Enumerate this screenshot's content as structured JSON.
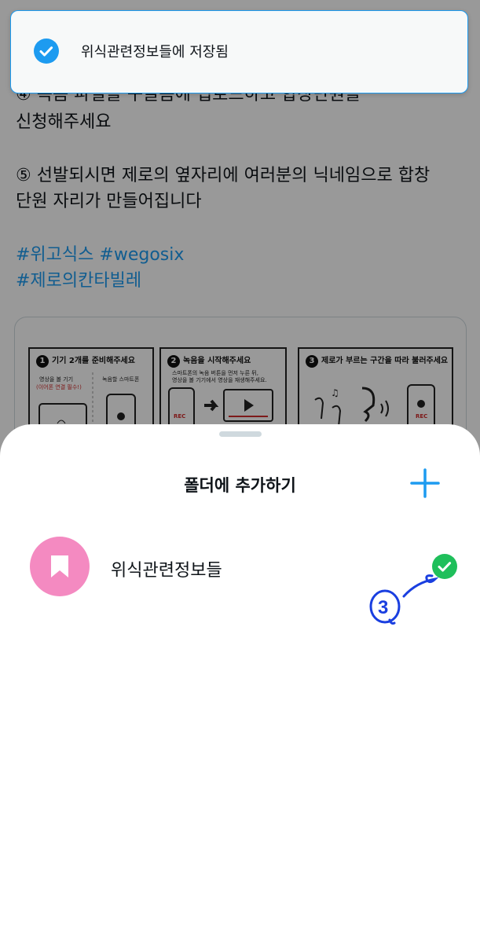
{
  "toast": {
    "message": "위식관련정보들에 저장됨",
    "icon": "check-circle-icon",
    "accent": "#1d9bf0"
  },
  "tweet": {
    "lines": [
      "④ 녹음 파일을 구글폼에 업로드하고 합창단원을",
      "신청해주세요",
      "⑤ 선발되시면 제로의 옆자리에 여러분의 닉네임으로 합창",
      "단원 자리가 만들어집니다"
    ],
    "hashtags": [
      "#위고식스 #wegosix",
      "#제로의칸타빌레"
    ],
    "link_color": "#1d9bf0"
  },
  "media": {
    "panels": [
      {
        "number": "1",
        "title": "기기 2개를 준비해주세요",
        "sub_left": "영상을 볼 기기",
        "sub_left_note": "(이어폰 연결 필수!)",
        "sub_right": "녹음할 스마트폰"
      },
      {
        "number": "2",
        "title": "녹음을 시작해주세요",
        "sub_line1": "스마트폰의 녹음 버튼을 먼저 누른 뒤,",
        "sub_line2": "영상을 볼 기기에서 영상을 재생해주세요.",
        "rec_label": "REC"
      },
      {
        "number": "3",
        "title": "제로가 부르는 구간을 따라 불러주세요",
        "rec_label": "REC"
      }
    ]
  },
  "sheet": {
    "title": "폴더에 추가하기",
    "add_icon": "plus-icon",
    "folders": [
      {
        "name": "위식관련정보들",
        "icon": "bookmark-icon",
        "avatar_color": "#f48ac1",
        "selected": true
      }
    ],
    "check_color": "#1fbf5b"
  },
  "annotation": {
    "text": "3",
    "color": "#1a3fe0"
  }
}
